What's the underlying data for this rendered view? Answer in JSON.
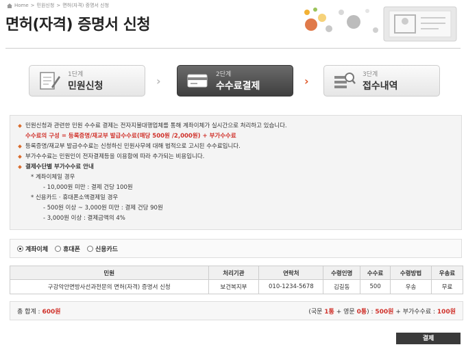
{
  "breadcrumb": {
    "home": "Home",
    "sep1": ">",
    "level1": "민원신청",
    "sep2": ">",
    "level2": "면허(자격) 증명서 신청"
  },
  "page_title": "면허(자격) 증명서 신청",
  "steps": [
    {
      "num": "1단계",
      "label": "민원신청",
      "icon": "document-pen-icon"
    },
    {
      "num": "2단계",
      "label": "수수료결제",
      "icon": "credit-card-icon"
    },
    {
      "num": "3단계",
      "label": "접수내역",
      "icon": "search-list-icon"
    }
  ],
  "step_arrow": "›",
  "info": {
    "line1": "민원신청과 관련한 민원 수수료 결제는 전자지불대행업체를 통해 계좌이체가 실시간으로 처리하고 있습니다.",
    "line2": "수수료의 구성 = 등록증명/재교부 발급수수료(매당 500원 /2,000원) + 부가수수료",
    "line3": "등록증명/재교부 발급수수료는 신청하신 민원사무에 대해 법적으로 고시된 수수료입니다.",
    "line4": "부가수수료는 민원인이 전자결제등을 이용함에 따라 추가되는 비용입니다.",
    "line5": "결제수단별 부가수수료 안내",
    "line6": "* 계좌이체일 경우",
    "line7": "- 10,000원 미만 : 결제 건당 100원",
    "line8": "* 신용카드 · 휴대폰소액결제일 경우",
    "line9": "- 500원 이상 ~ 3,000원 미만 : 결제 건당 90원",
    "line10": "- 3,000원 이상 : 결제금액의 4%"
  },
  "payment_methods": [
    {
      "label": "계좌이체",
      "selected": true
    },
    {
      "label": "휴대폰",
      "selected": false
    },
    {
      "label": "신용카드",
      "selected": false
    }
  ],
  "table": {
    "headers": [
      "민원",
      "처리기관",
      "연락처",
      "수령인명",
      "수수료",
      "수령방법",
      "우송료"
    ],
    "rows": [
      [
        "구강악안면방사선과전문의 면허(자격) 증명서 신청",
        "보건복지부",
        "010-1234-5678",
        "김길동",
        "500",
        "우송",
        "무료"
      ]
    ]
  },
  "total": {
    "label": "총 합계 :",
    "amount": "600원",
    "detail_prefix": "(국문",
    "kor_count": "1통",
    "plus1": "+ 영문",
    "eng_count": "0통",
    "detail_mid": ") :",
    "fee": "500원",
    "plus2": "+ 부가수수료 :",
    "extra_fee": "100원"
  },
  "pay_button": "결제",
  "colors": {
    "accent_red": "#d0322b",
    "bullet_orange": "#d96a2b",
    "active_step": "#4a4a4a",
    "arrow_orange": "#e05a2a"
  }
}
